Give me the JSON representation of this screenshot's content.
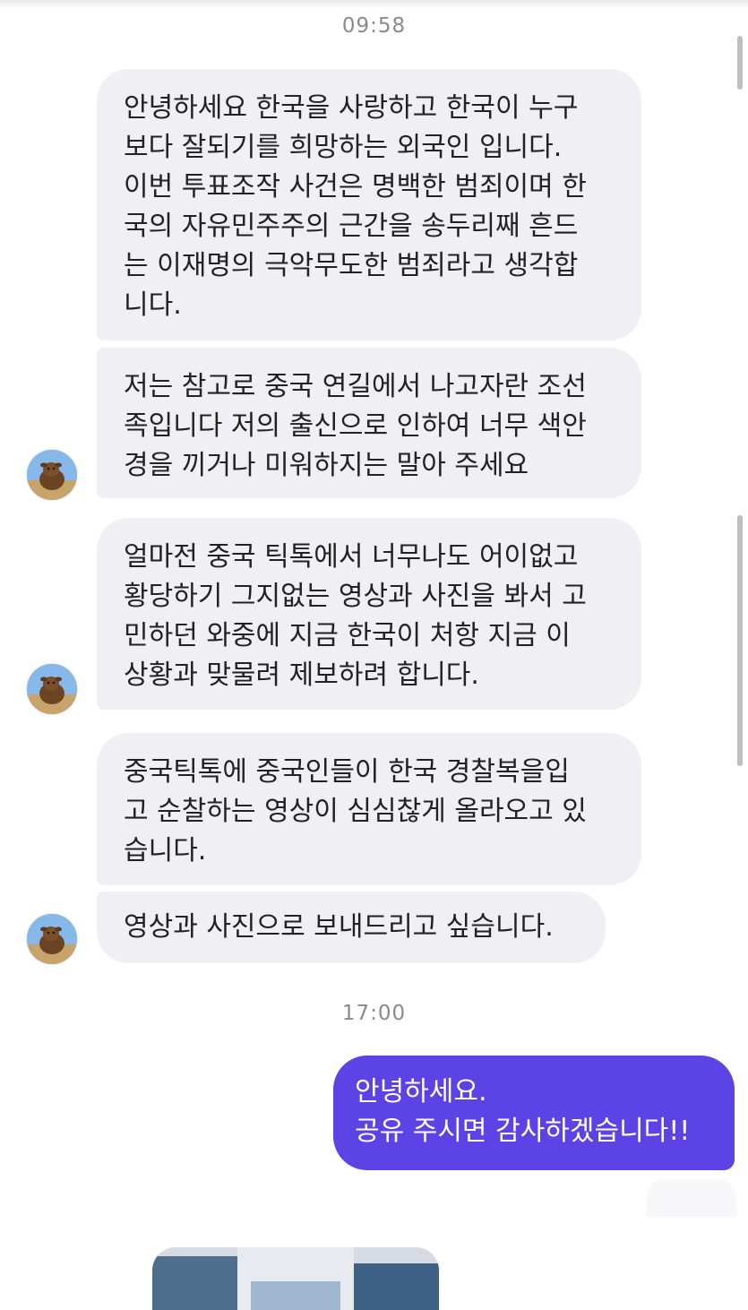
{
  "timestamps": [
    "09:58",
    "17:00"
  ],
  "incoming_messages": [
    "안녕하세요 한국을 사랑하고 한국이 누구\n보다 잘되기를 희망하는 외국인 입니다.\n이번 투표조작 사건은 명백한 범죄이며 한\n국의 자유민주주의 근간을 송두리째 흔드\n는 이재명의 극악무도한 범죄라고 생각합\n니다.",
    "저는 참고로 중국 연길에서 나고자란 조선\n족입니다 저의 출신으로 인하여 너무 색안\n경을 끼거나 미워하지는 말아 주세요",
    "얼마전 중국 틱톡에서 너무나도 어이없고\n황당하기 그지없는 영상과 사진을 봐서 고\n민하던 와중에 지금 한국이 처항 지금 이\n상황과 맞물려 제보하려 합니다.",
    "중국틱톡에 중국인들이 한국 경찰복을입\n고 순찰하는 영상이 심심찮게 올라오고 있\n습니다.",
    "영상과 사진으로 보내드리고 싶습니다."
  ],
  "outgoing_messages": [
    "안녕하세요.\n공유 주시면 감사하겠습니다!!"
  ],
  "colors": {
    "incoming_bubble": "#efeff4",
    "outgoing_bubble": "#5b43e6",
    "timestamp": "#8a8a8e"
  },
  "icons": {
    "avatar": "avatar-calf-photo"
  }
}
